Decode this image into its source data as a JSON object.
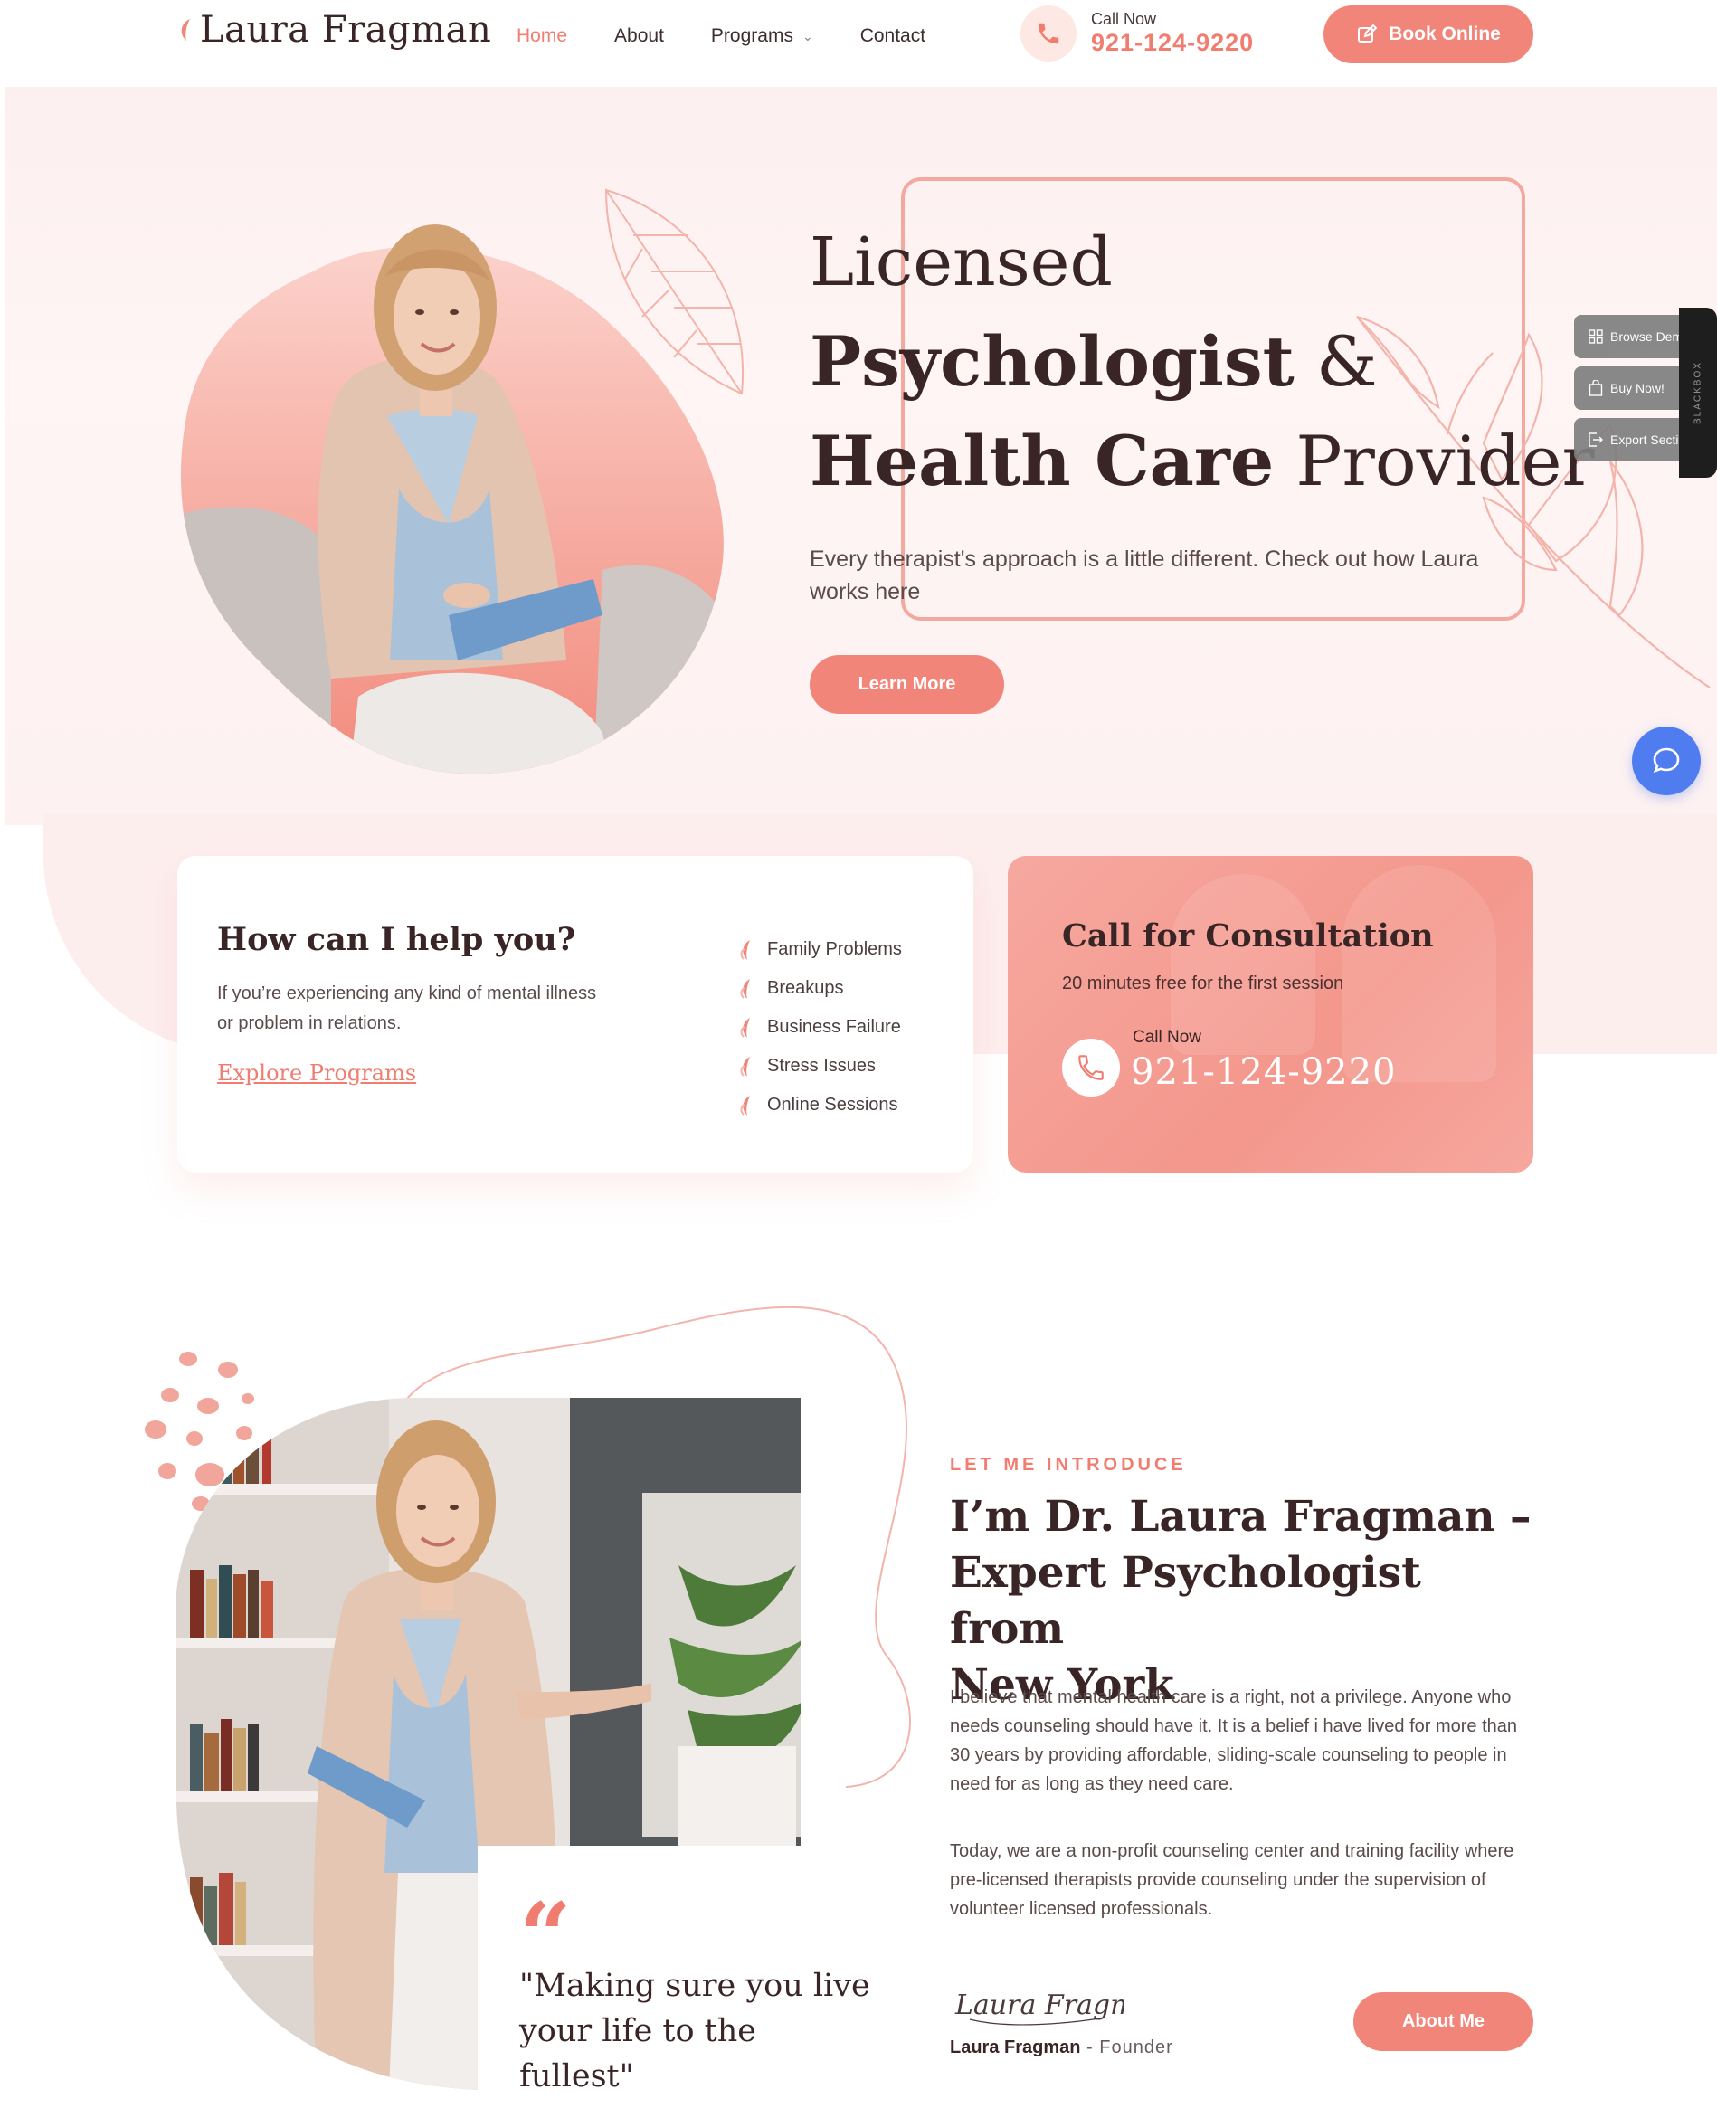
{
  "header": {
    "logo_text": "Laura Fragman",
    "nav": [
      {
        "label": "Home",
        "active": true
      },
      {
        "label": "About",
        "active": false
      },
      {
        "label": "Programs",
        "active": false
      },
      {
        "label": "Contact",
        "active": false
      }
    ],
    "call_label": "Call Now",
    "call_number": "921-124-9220",
    "book_label": "Book Online"
  },
  "hero": {
    "title_line1": "Licensed",
    "title_line2_bold": "Psychologist",
    "title_line2_rest": " &",
    "title_line3_bold": "Health Care",
    "title_line3_rest": " Provider",
    "description": "Every therapist's approach is a little different. Check out how Laura works here",
    "cta_label": "Learn More"
  },
  "side_tools": {
    "browse": "Browse Demos",
    "buy": "Buy Now!",
    "export": "Export Section",
    "brand": "BLACKBOX"
  },
  "help_card": {
    "title": "How can I help you?",
    "description": "If you’re experiencing any kind of mental illness or problem in relations.",
    "link_label": "Explore Programs",
    "items": [
      "Family Problems",
      "Breakups",
      "Business Failure",
      "Stress Issues",
      "Online Sessions"
    ]
  },
  "consult_card": {
    "title": "Call for Consultation",
    "subtitle": "20 minutes free for the first session",
    "call_label": "Call Now",
    "call_number": "921-124-9220"
  },
  "intro": {
    "eyebrow": "LET ME INTRODUCE",
    "title_bold": "I’m Dr. Laura Fragman – Expert Psychologist from",
    "title_rest": "New York",
    "paragraph1": "I believe that mental health care is a right, not a privilege. Anyone who needs counseling should have it. It is a belief i have lived for more than 30 years by providing affordable, sliding-scale counseling to people in need for as long as they need care.",
    "paragraph2": "Today, we are a non-profit counseling center and training facility where pre-licensed therapists provide counseling under the supervision of volunteer licensed professionals.",
    "quote_mark": "“",
    "quote": "\"Making sure you live your life to the fullest\"",
    "signature_script": "Laura Fragman",
    "signature_name": "Laura Fragman",
    "signature_role": " - Founder",
    "about_label": "About Me"
  },
  "colors": {
    "accent": "#f2857a",
    "accent_text": "#f07d6f",
    "dark_text": "#3a2526",
    "hero_bg": "#fdf1f1",
    "chat": "#4f7df0"
  }
}
